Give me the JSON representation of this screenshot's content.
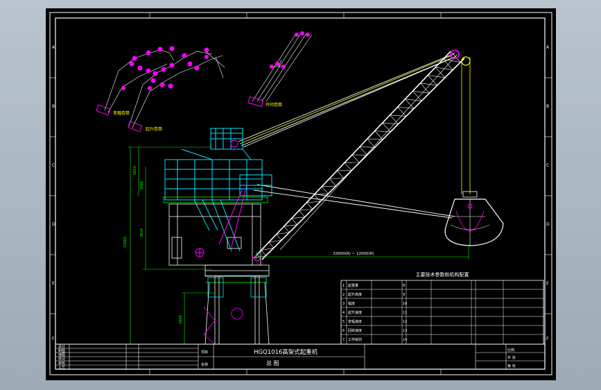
{
  "drawing": {
    "title": "HGQ1016高架式起重机",
    "subtitle": "总  图",
    "zone_letters": [
      "A",
      "B",
      "C",
      "D",
      "E",
      "F"
    ]
  },
  "reeving_labels": {
    "luffing_drum": "变幅卷筒",
    "open_close_drum": "开闭卷筒",
    "hoist_drum": "起升卷筒"
  },
  "dimensions": {
    "reach": "33000(R) ~ 12000(R)"
  },
  "spec_table": {
    "title": "主要技术参数和机构配置",
    "rows": [
      {
        "n": "1",
        "label": "起重量",
        "v1": "",
        "n2": "8",
        "label2": "",
        "v2": "",
        "v3": "",
        "v4": ""
      },
      {
        "n": "2",
        "label": "起升高度",
        "v1": "",
        "n2": "9",
        "label2": "",
        "v2": "",
        "v3": "",
        "v4": ""
      },
      {
        "n": "3",
        "label": "幅度",
        "v1": "",
        "n2": "10",
        "label2": "",
        "v2": "",
        "v3": "",
        "v4": ""
      },
      {
        "n": "4",
        "label": "起升速度",
        "v1": "",
        "n2": "11",
        "label2": "",
        "v2": "",
        "v3": "",
        "v4": ""
      },
      {
        "n": "5",
        "label": "变幅速度",
        "v1": "",
        "n2": "12",
        "label2": "",
        "v2": "",
        "v3": "",
        "v4": ""
      },
      {
        "n": "6",
        "label": "回转速度",
        "v1": "",
        "n2": "13",
        "label2": "",
        "v2": "",
        "v3": "",
        "v4": ""
      },
      {
        "n": "7",
        "label": "工作级别",
        "v1": "",
        "n2": "14",
        "label2": "",
        "v2": "",
        "v3": "",
        "v4": ""
      }
    ]
  },
  "title_block": {
    "left": [
      "设计",
      "制图",
      "描图",
      "校对",
      "审核",
      "工艺"
    ],
    "mid": [
      "",
      "",
      "",
      "",
      "",
      ""
    ],
    "project_label": "项目",
    "name_label": "名称",
    "scale_label": "比例",
    "sheet_label": "共 张",
    "total_label": "第 张"
  },
  "colors": {
    "frame": "#ffffff",
    "structure": "#00e5ff",
    "boom": "#ffffff",
    "rope": "#ffff00",
    "sheave": "#ff00ff",
    "dimension": "#00ff00",
    "label": "#ffff00"
  }
}
